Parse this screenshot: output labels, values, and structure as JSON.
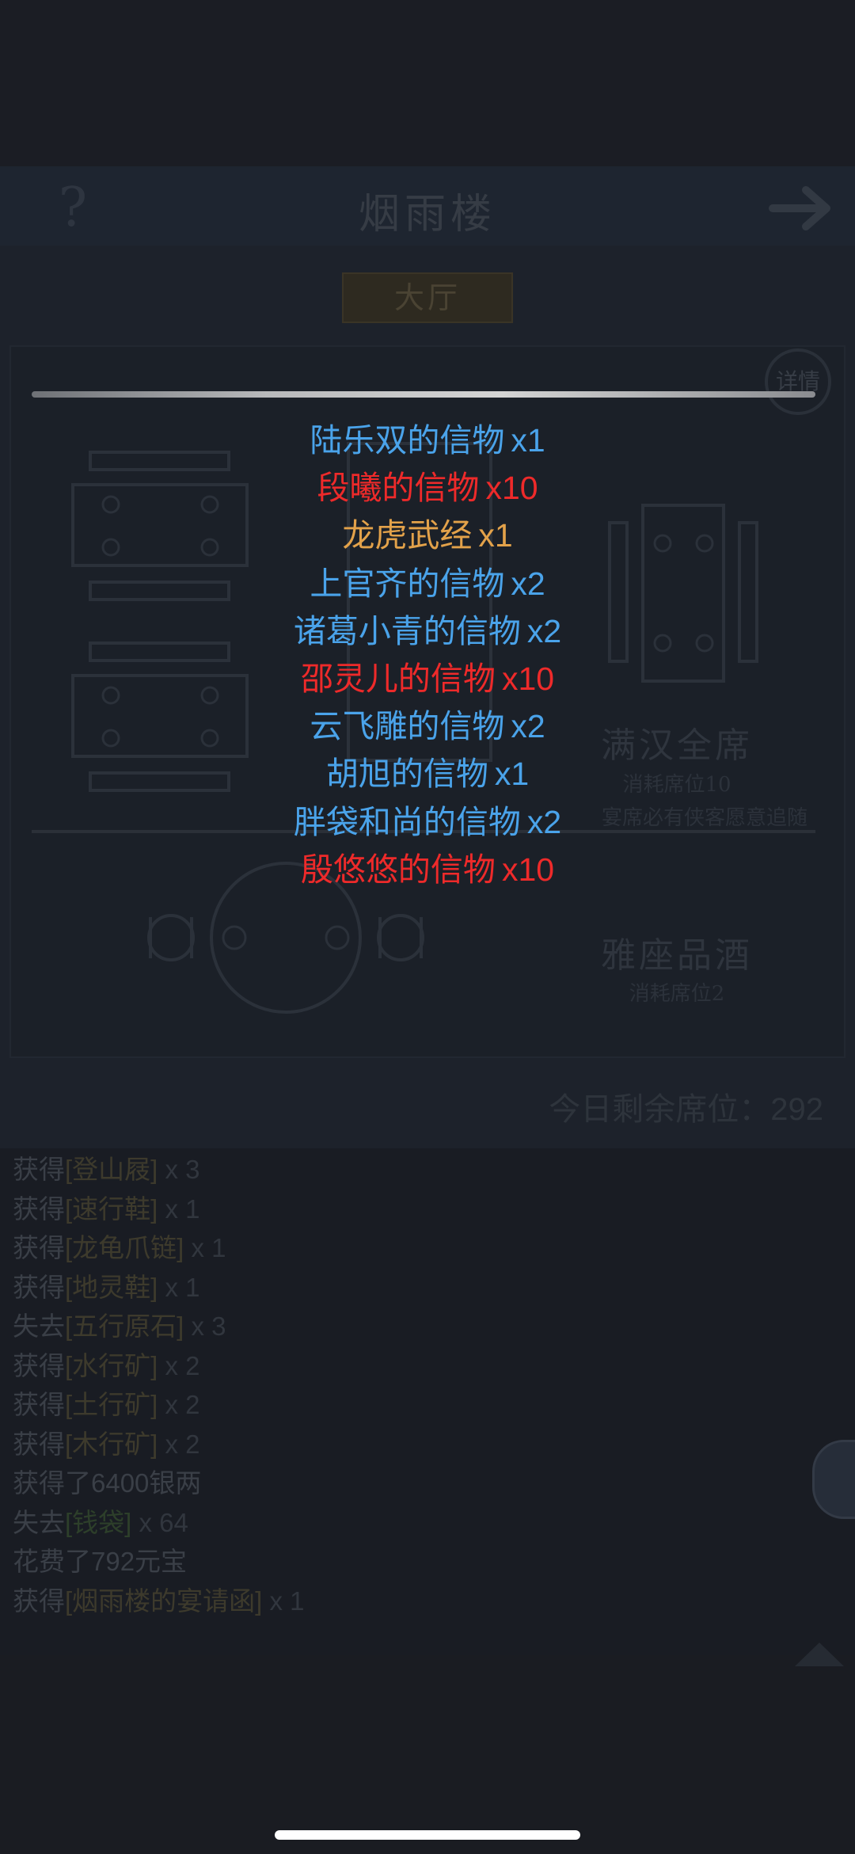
{
  "header": {
    "title": "烟雨楼",
    "help_icon": "question-mark-icon",
    "forward_icon": "arrow-right-icon"
  },
  "tabs": {
    "hall": "大厅"
  },
  "panel": {
    "detail_label": "详情",
    "feast": {
      "title": "满汉全席",
      "cost": "消耗席位10",
      "note": "宴席必有侠客愿意追随"
    },
    "wine": {
      "title": "雅座品酒",
      "cost": "消耗席位2"
    },
    "seats_remaining": "今日剩余席位：292"
  },
  "log": [
    {
      "prefix": "获得",
      "item": "[登山屐]",
      "qty": " x 3",
      "item_color": "yellow"
    },
    {
      "prefix": "获得",
      "item": "[速行鞋]",
      "qty": " x 1",
      "item_color": "yellow"
    },
    {
      "prefix": "获得",
      "item": "[龙龟爪链]",
      "qty": " x 1",
      "item_color": "yellow"
    },
    {
      "prefix": "获得",
      "item": "[地灵鞋]",
      "qty": " x 1",
      "item_color": "yellow"
    },
    {
      "prefix": "失去",
      "item": "[五行原石]",
      "qty": " x 3",
      "item_color": "yellow"
    },
    {
      "prefix": "获得",
      "item": "[水行矿]",
      "qty": " x 2",
      "item_color": "yellow"
    },
    {
      "prefix": "获得",
      "item": "[土行矿]",
      "qty": " x 2",
      "item_color": "yellow"
    },
    {
      "prefix": "获得",
      "item": "[木行矿]",
      "qty": " x 2",
      "item_color": "yellow"
    },
    {
      "prefix": "获得了6400银两",
      "item": "",
      "qty": "",
      "item_color": "none"
    },
    {
      "prefix": "失去",
      "item": "[钱袋]",
      "qty": " x 64",
      "item_color": "green"
    },
    {
      "prefix": "花费了792元宝",
      "item": "",
      "qty": "",
      "item_color": "none"
    },
    {
      "prefix": "获得",
      "item": "[烟雨楼的宴请函]",
      "qty": " x 1",
      "item_color": "yellow"
    }
  ],
  "rewards": [
    {
      "name": "陆乐双的信物",
      "qty": "x1",
      "color": "#4aa3ea"
    },
    {
      "name": "段曦的信物",
      "qty": "x10",
      "color": "#ee2a2a"
    },
    {
      "name": "龙虎武经",
      "qty": "x1",
      "color": "#e3a24a"
    },
    {
      "name": "上官齐的信物",
      "qty": "x2",
      "color": "#4aa3ea"
    },
    {
      "name": "诸葛小青的信物",
      "qty": "x2",
      "color": "#4aa3ea"
    },
    {
      "name": "邵灵儿的信物",
      "qty": "x10",
      "color": "#ee2a2a"
    },
    {
      "name": "云飞雕的信物",
      "qty": "x2",
      "color": "#4aa3ea"
    },
    {
      "name": "胡旭的信物",
      "qty": "x1",
      "color": "#4aa3ea"
    },
    {
      "name": "胖袋和尚的信物",
      "qty": "x2",
      "color": "#4aa3ea"
    },
    {
      "name": "殷悠悠的信物",
      "qty": "x10",
      "color": "#ee2a2a"
    }
  ]
}
